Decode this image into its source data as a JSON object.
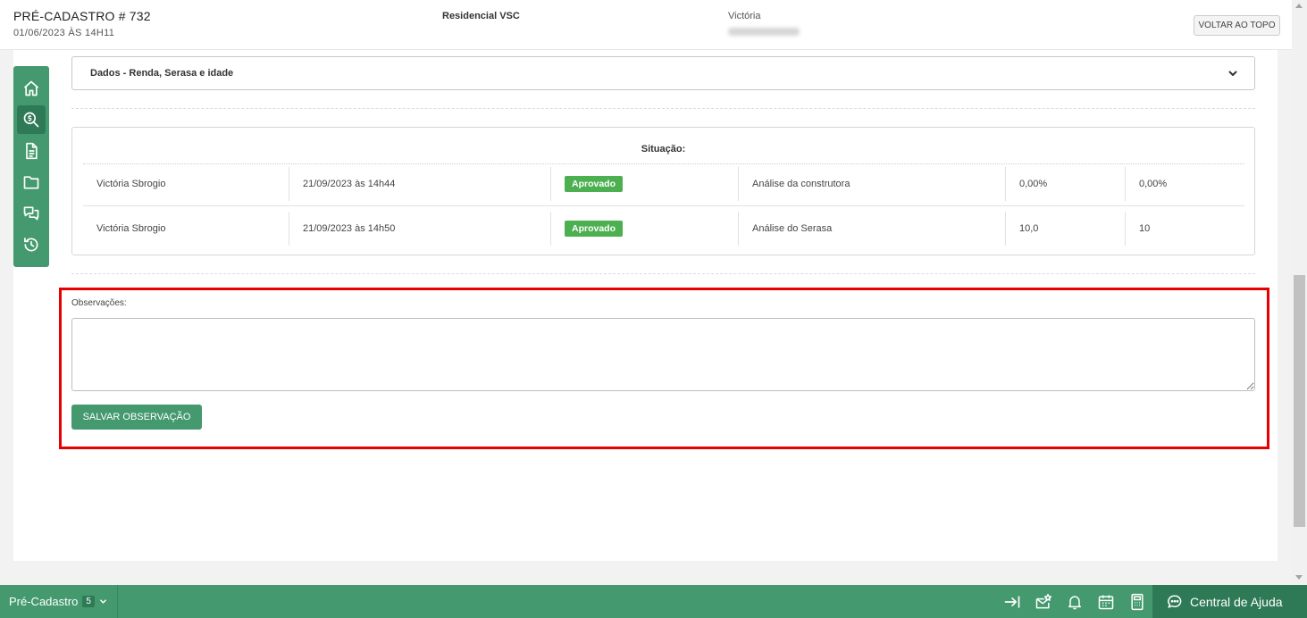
{
  "header": {
    "title": "PRÉ-CADASTRO # 732",
    "date": "01/06/2023 ÀS 14H11",
    "project": "Residencial VSC",
    "client_name": "Victória",
    "back_to_top_label": "VOLTAR AO TOPO"
  },
  "sidebar": {
    "items": [
      {
        "icon": "home-icon",
        "active": false
      },
      {
        "icon": "search-dollar-icon",
        "active": true
      },
      {
        "icon": "document-icon",
        "active": false
      },
      {
        "icon": "folder-icon",
        "active": false
      },
      {
        "icon": "chat-icon",
        "active": false
      },
      {
        "icon": "history-icon",
        "active": false
      }
    ]
  },
  "accordion": {
    "label": "Dados - Renda, Serasa e idade"
  },
  "situacao": {
    "title": "Situação:",
    "rows": [
      {
        "user": "Victória Sbrogio",
        "datetime": "21/09/2023 às 14h44",
        "status": "Aprovado",
        "analysis": "Análise da construtora",
        "value1": "0,00%",
        "value2": "0,00%"
      },
      {
        "user": "Victória Sbrogio",
        "datetime": "21/09/2023 às 14h50",
        "status": "Aprovado",
        "analysis": "Análise do Serasa",
        "value1": "10,0",
        "value2": "10"
      }
    ]
  },
  "observations": {
    "label": "Observações:",
    "value": "",
    "save_label": "SALVAR OBSERVAÇÃO"
  },
  "bottombar": {
    "tab_label": "Pré-Cadastro",
    "tab_count": "5",
    "icons": [
      "arrow-right-bar-icon",
      "envelope-star-icon",
      "bell-icon",
      "calendar-icon",
      "calculator-icon"
    ],
    "help_label": "Central de Ajuda"
  },
  "colors": {
    "primary": "#44996e",
    "primary_dark": "#2f7a56",
    "badge": "#4caf50",
    "highlight": "#e60000"
  }
}
